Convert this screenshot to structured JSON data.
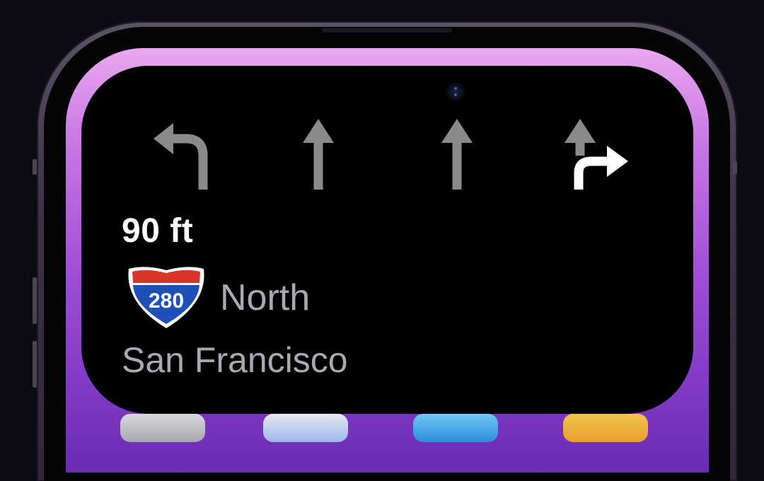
{
  "navigation": {
    "lanes": [
      {
        "direction": "left-turn",
        "icon": "turn-left-arrow-icon",
        "active": false
      },
      {
        "direction": "straight",
        "icon": "straight-arrow-icon",
        "active": false
      },
      {
        "direction": "straight",
        "icon": "straight-arrow-icon",
        "active": false
      },
      {
        "direction": "straight-or-right",
        "icon": "straight-right-arrow-icon",
        "active": true
      }
    ],
    "distance": "90 ft",
    "route_shield": {
      "number": "280",
      "icon": "interstate-shield-icon"
    },
    "direction": "North",
    "destination": "San Francisco"
  },
  "colors": {
    "inactive_arrow": "#8a8a8a",
    "active_arrow": "#ffffff",
    "secondary_text": "#a9a9b0",
    "shield_blue": "#1f4fb8",
    "shield_red": "#d8352b",
    "screen_accent": "#c978e4"
  }
}
